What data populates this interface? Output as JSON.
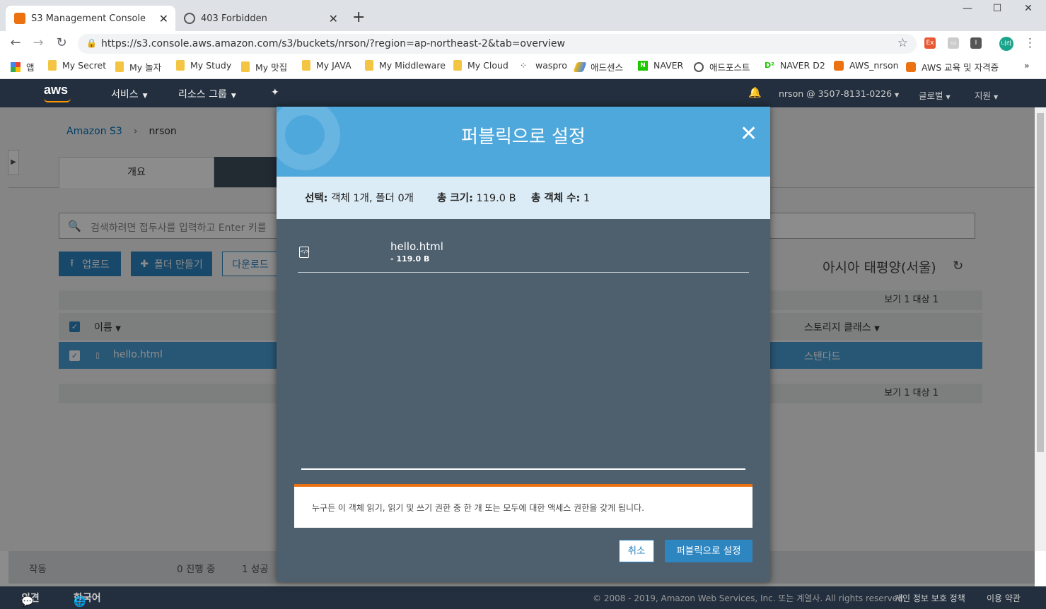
{
  "browser": {
    "tabs": [
      {
        "title": "S3 Management Console"
      },
      {
        "title": "403 Forbidden"
      }
    ],
    "url": "https://s3.console.aws.amazon.com/s3/buckets/nrson/?region=ap-northeast-2&tab=overview",
    "profile": "나라",
    "bookmarks": [
      {
        "label": "앱"
      },
      {
        "label": "My Secret"
      },
      {
        "label": "My 놀자"
      },
      {
        "label": "My Study"
      },
      {
        "label": "My 맛집"
      },
      {
        "label": "My JAVA"
      },
      {
        "label": "My Middleware"
      },
      {
        "label": "My Cloud"
      },
      {
        "label": "waspro"
      },
      {
        "label": "애드센스"
      },
      {
        "label": "NAVER"
      },
      {
        "label": "애드포스트"
      },
      {
        "label": "NAVER D2"
      },
      {
        "label": "AWS_nrson"
      },
      {
        "label": "AWS 교육 및 자격증"
      }
    ]
  },
  "aws_header": {
    "logo": "aws",
    "services": "서비스",
    "resource_groups": "리소스 그룹",
    "account": "nrson @ 3507-8131-0226",
    "region": "글로벌",
    "support": "지원"
  },
  "console": {
    "breadcrumb": {
      "root": "Amazon S3",
      "current": "nrson"
    },
    "tab_overview": "개요",
    "search_placeholder": "검색하려면 접두사를 입력하고 Enter 키를",
    "buttons": {
      "upload": "업로드",
      "create_folder": "폴더 만들기",
      "download": "다운로드"
    },
    "region_label": "아시아 태평양(서울)",
    "pager": "보기 1 대상 1",
    "columns": {
      "name": "이름",
      "storage_class": "스토리지 클래스"
    },
    "rows": [
      {
        "name": "hello.html",
        "storage_class": "스탠다드"
      }
    ],
    "status": {
      "label": "작동",
      "in_progress": "0 진행 중",
      "success": "1 성공"
    }
  },
  "footer": {
    "feedback": "의견",
    "language": "한국어",
    "copyright": "© 2008 - 2019, Amazon Web Services, Inc. 또는 계열사. All rights reserved.",
    "privacy": "개인 정보 보호 정책",
    "terms": "이용 약관"
  },
  "modal": {
    "title": "퍼블릭으로 설정",
    "summary": {
      "selection_label": "선택:",
      "selection_value": "객체 1개, 폴더 0개",
      "size_label": "총 크기:",
      "size_value": "119.0 B",
      "count_label": "총 객체 수:",
      "count_value": "1"
    },
    "file": {
      "name": "hello.html",
      "size": "- 119.0 B"
    },
    "warning": "누구든 이 객체 읽기, 읽기 및 쓰기 권한 중 한 개 또는 모두에 대한 액세스 권한을 갖게 됩니다.",
    "cancel": "취소",
    "confirm": "퍼블릭으로 설정"
  },
  "colors": {
    "aws_dark": "#232f3e",
    "modal_header": "#4fa8dc",
    "modal_body": "#4e5f6e",
    "primary_button": "#2e86c1",
    "warning_accent": "#ec7211"
  }
}
